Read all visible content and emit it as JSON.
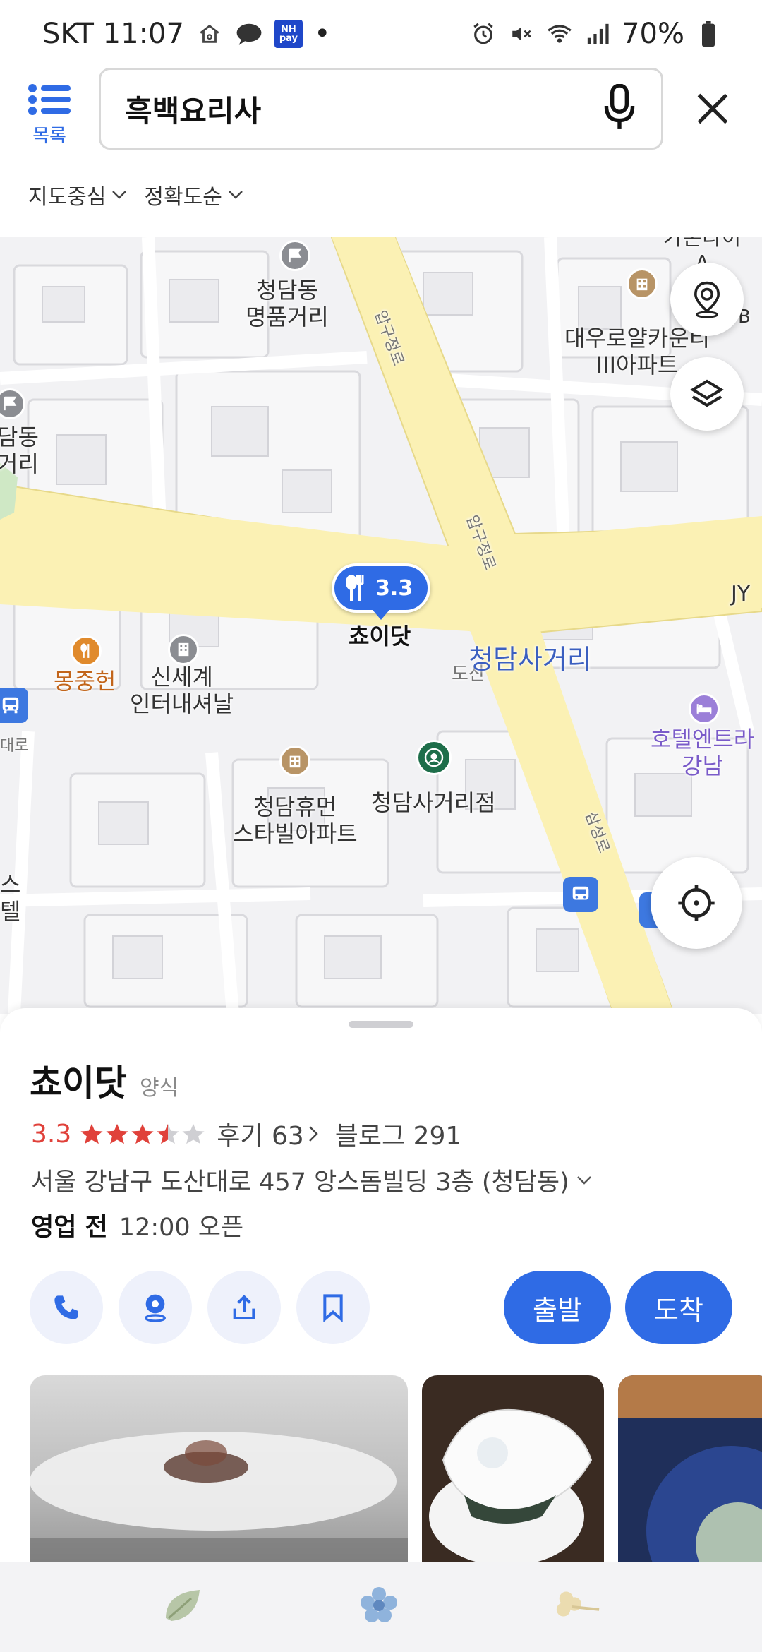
{
  "status_bar": {
    "carrier_time": "SKT 11:07",
    "nhpay": "NH pay",
    "dot": "•",
    "battery": "70%"
  },
  "header": {
    "list_label": "목록",
    "search_query": "흑백요리사",
    "filters": [
      "지도중심",
      "정확도순"
    ]
  },
  "map": {
    "labels": {
      "cheongdam_luxury": "청담동\n명품거리",
      "daewoo": "대우로얄카운티\nIII아파트",
      "cheongdam_left": "담동\n거리",
      "choidot_marker": "쵸이닷",
      "monjunghun": "몽중헌",
      "shinsegae": "신세계\n인터내셔날",
      "intersection": "청담사거리",
      "dosan": "도산",
      "hotel": "호텔엔트라\n강남",
      "cheongdam_hume": "청담휴먼\n스타빌아파트",
      "starbucks": "청담사거리점",
      "apgujeong1": "압구정로",
      "apgujeong2": "압구정로",
      "samseong": "삼성로",
      "daero": "대로",
      "jy": "JY",
      "top_right": "가온다이\nA",
      "b": "B",
      "left_bottom": "스\n텔"
    },
    "marker_rating": "3.3"
  },
  "place": {
    "name": "쵸이닷",
    "category": "양식",
    "rating": "3.3",
    "stars": 3.5,
    "reviews": "후기 63",
    "blog": "블로그 291",
    "address": "서울 강남구 도산대로 457 앙스돔빌딩 3층 (청담동)",
    "hours_status": "영업 전",
    "hours_open": "12:00 오픈",
    "depart_label": "출발",
    "arrive_label": "도착"
  },
  "colors": {
    "accent": "#2f6be5",
    "rating_red": "#e0413a",
    "road_yellow": "#fbf1b4",
    "map_bg": "#f2f2f4"
  }
}
